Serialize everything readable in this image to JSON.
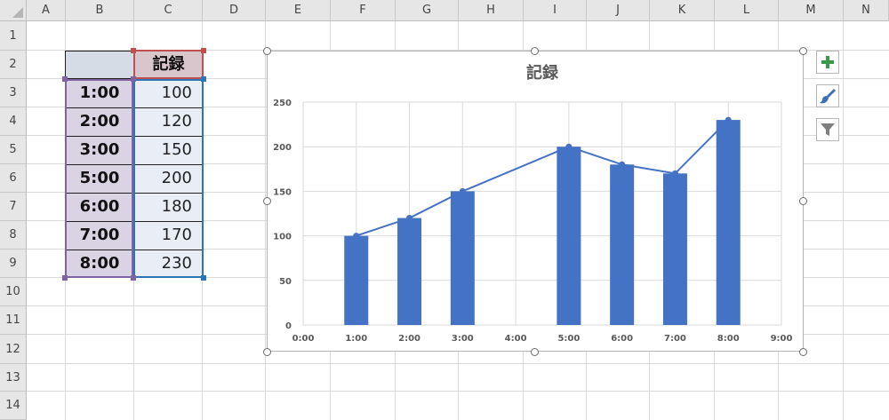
{
  "sheet": {
    "columns": [
      "A",
      "B",
      "C",
      "D",
      "E",
      "F",
      "G",
      "H",
      "I",
      "J",
      "K",
      "L",
      "M",
      "N"
    ],
    "rows": [
      "1",
      "2",
      "3",
      "4",
      "5",
      "6",
      "7",
      "8",
      "9",
      "10",
      "11",
      "12",
      "13",
      "14"
    ]
  },
  "table": {
    "header_b": "",
    "header_c": "記録",
    "rows": [
      {
        "label": "1:00",
        "value": "100"
      },
      {
        "label": "2:00",
        "value": "120"
      },
      {
        "label": "3:00",
        "value": "150"
      },
      {
        "label": "5:00",
        "value": "200"
      },
      {
        "label": "6:00",
        "value": "180"
      },
      {
        "label": "7:00",
        "value": "170"
      },
      {
        "label": "8:00",
        "value": "230"
      }
    ]
  },
  "chart_tools": {
    "add_icon": "plus-icon",
    "style_icon": "brush-icon",
    "filter_icon": "filter-icon"
  },
  "colors": {
    "bar": "#4472c4",
    "line": "#4472c4",
    "select_green": "#217346"
  },
  "chart_data": {
    "type": "bar",
    "title": "記録",
    "x": [
      1,
      2,
      3,
      5,
      6,
      7,
      8
    ],
    "x_labels": [
      "0:00",
      "1:00",
      "2:00",
      "3:00",
      "4:00",
      "5:00",
      "6:00",
      "7:00",
      "8:00",
      "9:00"
    ],
    "values": [
      100,
      120,
      150,
      200,
      180,
      170,
      230
    ],
    "overlay": "line",
    "xlim": [
      0,
      9
    ],
    "ylim": [
      0,
      250
    ],
    "yticks": [
      0,
      50,
      100,
      150,
      200,
      250
    ],
    "grid": true,
    "legend": "none"
  }
}
